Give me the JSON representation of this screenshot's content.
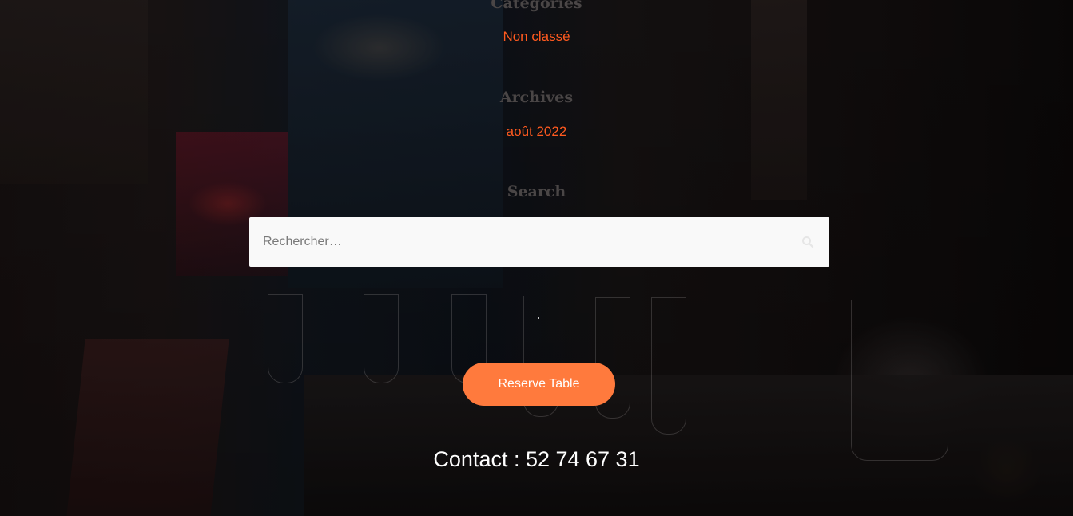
{
  "widgets": {
    "categories": {
      "title": "Catégories",
      "link": "Non classé"
    },
    "archives": {
      "title": "Archives",
      "link": "août 2022"
    },
    "search": {
      "title": "Search",
      "placeholder": "Rechercher…",
      "icon": "search-icon"
    }
  },
  "cta": {
    "reserve_label": "Reserve Table"
  },
  "footer": {
    "contact": "Contact : 52 74 67 31"
  },
  "colors": {
    "accent_link": "#ff5a1f",
    "button": "#ff7a3d",
    "widget_title": "#4a4646"
  }
}
